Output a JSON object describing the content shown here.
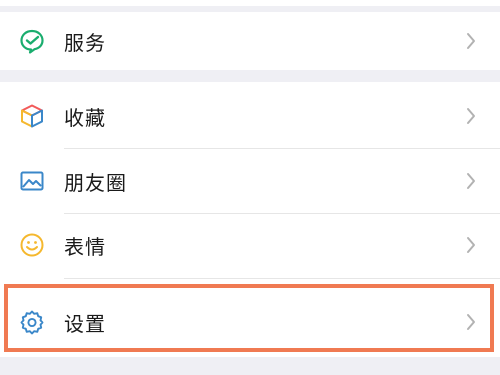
{
  "services_group": {
    "items": [
      {
        "label": "服务",
        "icon": "wechat-pay-icon"
      }
    ]
  },
  "main_group": {
    "items": [
      {
        "label": "收藏",
        "icon": "favorites-cube-icon"
      },
      {
        "label": "朋友圈",
        "icon": "moments-image-icon"
      },
      {
        "label": "表情",
        "icon": "sticker-smile-icon"
      },
      {
        "label": "设置",
        "icon": "settings-gear-icon"
      }
    ]
  },
  "colors": {
    "background": "#efeff4",
    "highlight_border": "#f07a52",
    "services_icon": "#1aad6e",
    "settings_icon": "#3a87c9"
  }
}
